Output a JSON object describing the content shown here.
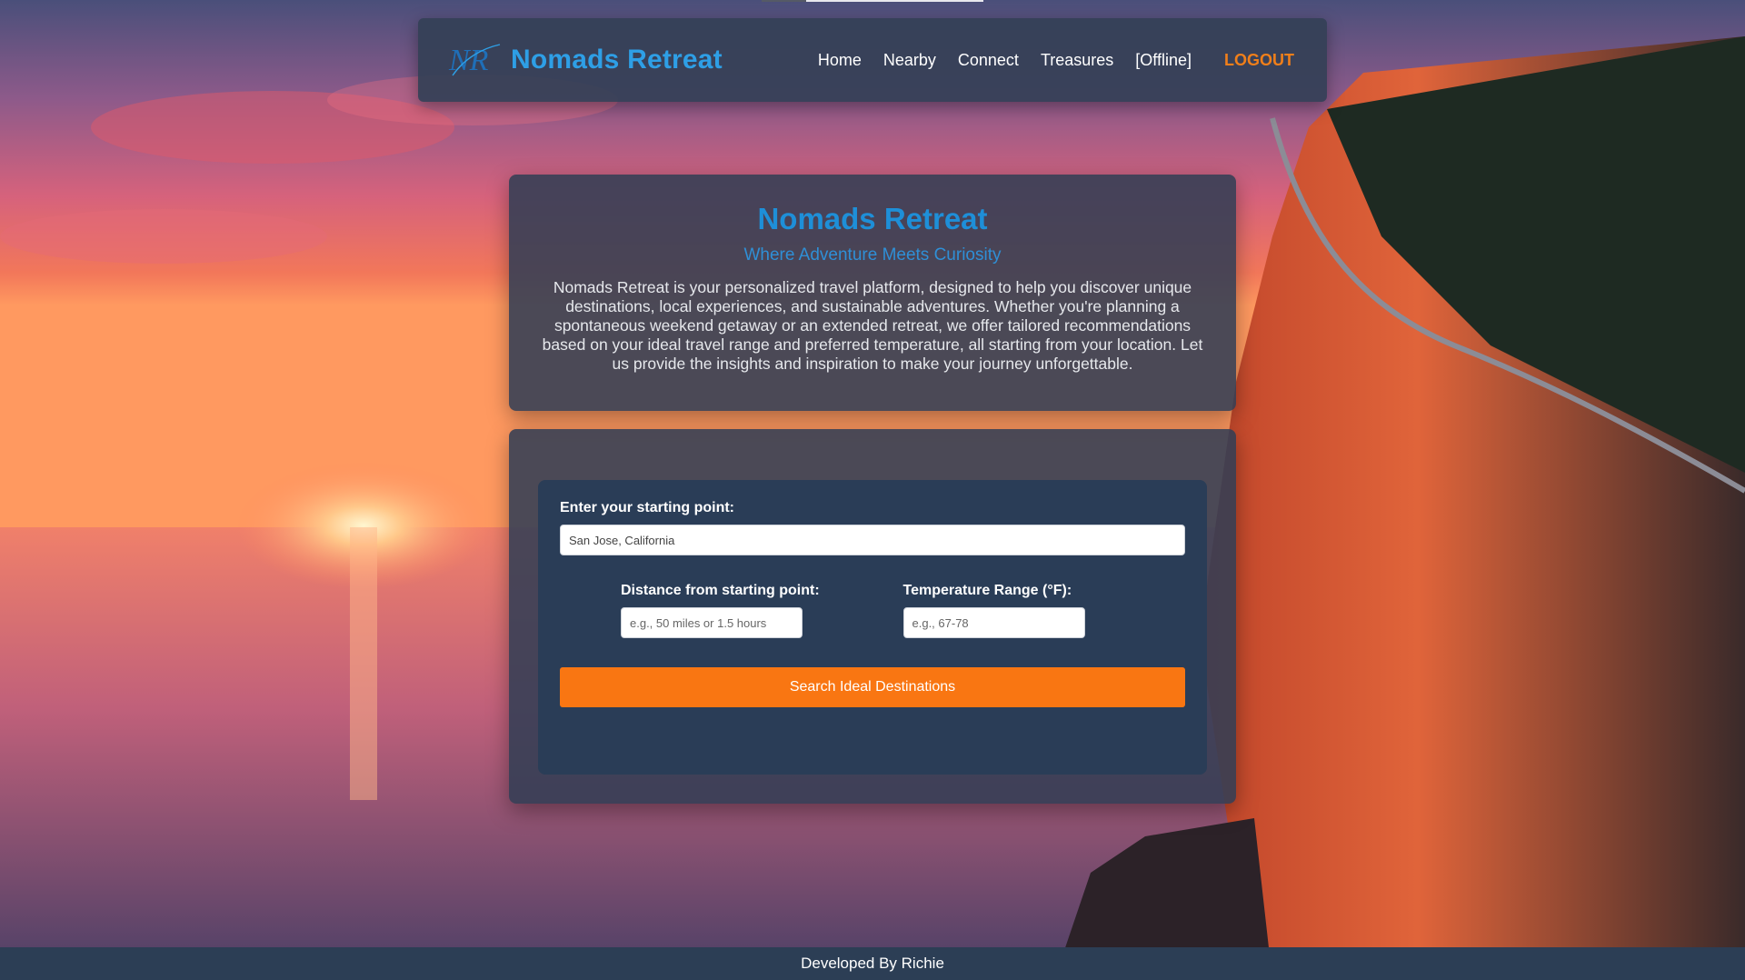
{
  "nav": {
    "brand": "Nomads Retreat",
    "logo_text": "NR",
    "links": [
      "Home",
      "Nearby",
      "Connect",
      "Treasures",
      "[Offline]"
    ],
    "logout": "LOGOUT"
  },
  "intro": {
    "title": "Nomads Retreat",
    "subtitle": "Where Adventure Meets Curiosity",
    "body": "Nomads Retreat is your personalized travel platform, designed to help you discover unique destinations, local experiences, and sustainable adventures. Whether you're planning a spontaneous weekend getaway or an extended retreat, we offer tailored recommendations based on your ideal travel range and preferred temperature, all starting from your location. Let us provide the insights and inspiration to make your journey unforgettable."
  },
  "search": {
    "start_label": "Enter your starting point:",
    "start_value": "San Jose, California",
    "distance_label": "Distance from starting point:",
    "distance_placeholder": "e.g., 50 miles or 1.5 hours",
    "temp_label": "Temperature Range (°F):",
    "temp_placeholder": "e.g., 67-78",
    "button": "Search Ideal Destinations"
  },
  "footer": {
    "text": "Developed By Richie"
  },
  "colors": {
    "brand_blue": "#2e9fe6",
    "accent_orange": "#f97612",
    "logout_orange": "#f07f1a",
    "panel": "#2a3d57"
  }
}
